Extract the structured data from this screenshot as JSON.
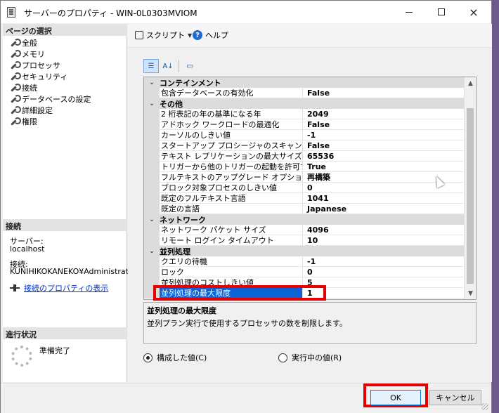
{
  "window": {
    "title": "サーバーのプロパティ - WIN-0L0303MVIOM",
    "buttons": {
      "minimize": "minimize",
      "maximize": "maximize",
      "close": "×"
    }
  },
  "left": {
    "page_select_header": "ページの選択",
    "pages": [
      "全般",
      "メモリ",
      "プロセッサ",
      "セキュリティ",
      "接続",
      "データベースの設定",
      "詳細設定",
      "権限"
    ],
    "connection_header": "接続",
    "server_label": "サーバー:",
    "server_value": "localhost",
    "conn_label": "接続:",
    "conn_value": "KUNIHIKOKANEKO¥Administrato",
    "conn_props_link": "接続のプロパティの表示",
    "progress_header": "進行状況",
    "progress_status": "準備完了"
  },
  "toolbar": {
    "script_label": "スクリプト",
    "help_label": "ヘルプ"
  },
  "grid": {
    "categories": [
      {
        "name": "コンテインメント",
        "rows": [
          {
            "name": "包含データベースの有効化",
            "value": "False"
          }
        ]
      },
      {
        "name": "その他",
        "rows": [
          {
            "name": "2 桁表記の年の基準になる年",
            "value": "2049"
          },
          {
            "name": "アドホック ワークロードの最適化",
            "value": "False"
          },
          {
            "name": "カーソルのしきい値",
            "value": "-1"
          },
          {
            "name": "スタートアップ プロシージャのスキャン",
            "value": "False"
          },
          {
            "name": "テキスト レプリケーションの最大サイズ",
            "value": "65536"
          },
          {
            "name": "トリガーから他のトリガーの起動を許可する",
            "value": "True"
          },
          {
            "name": "フルテキストのアップグレード オプション",
            "value": "再構築"
          },
          {
            "name": "ブロック対象プロセスのしきい値",
            "value": "0"
          },
          {
            "name": "既定のフルテキスト言語",
            "value": "1041"
          },
          {
            "name": "既定の言語",
            "value": "Japanese"
          }
        ]
      },
      {
        "name": "ネットワーク",
        "rows": [
          {
            "name": "ネットワーク パケット サイズ",
            "value": "4096"
          },
          {
            "name": "リモート ログイン タイムアウト",
            "value": "10"
          }
        ]
      },
      {
        "name": "並列処理",
        "rows": [
          {
            "name": "クエリの待機",
            "value": "-1"
          },
          {
            "name": "ロック",
            "value": "0"
          },
          {
            "name": "並列処理のコストしきい値",
            "value": "5"
          },
          {
            "name": "並列処理の最大限度",
            "value": "1"
          }
        ]
      }
    ]
  },
  "description": {
    "title": "並列処理の最大限度",
    "text": "並列プラン実行で使用するプロセッサの数を制限します。"
  },
  "radios": {
    "configured": "構成した値(C)",
    "running": "実行中の値(R)",
    "selected": "configured"
  },
  "buttons": {
    "ok": "OK",
    "cancel": "キャンセル"
  },
  "colors": {
    "selection": "#0a64d8",
    "highlight_red": "#e60000"
  }
}
